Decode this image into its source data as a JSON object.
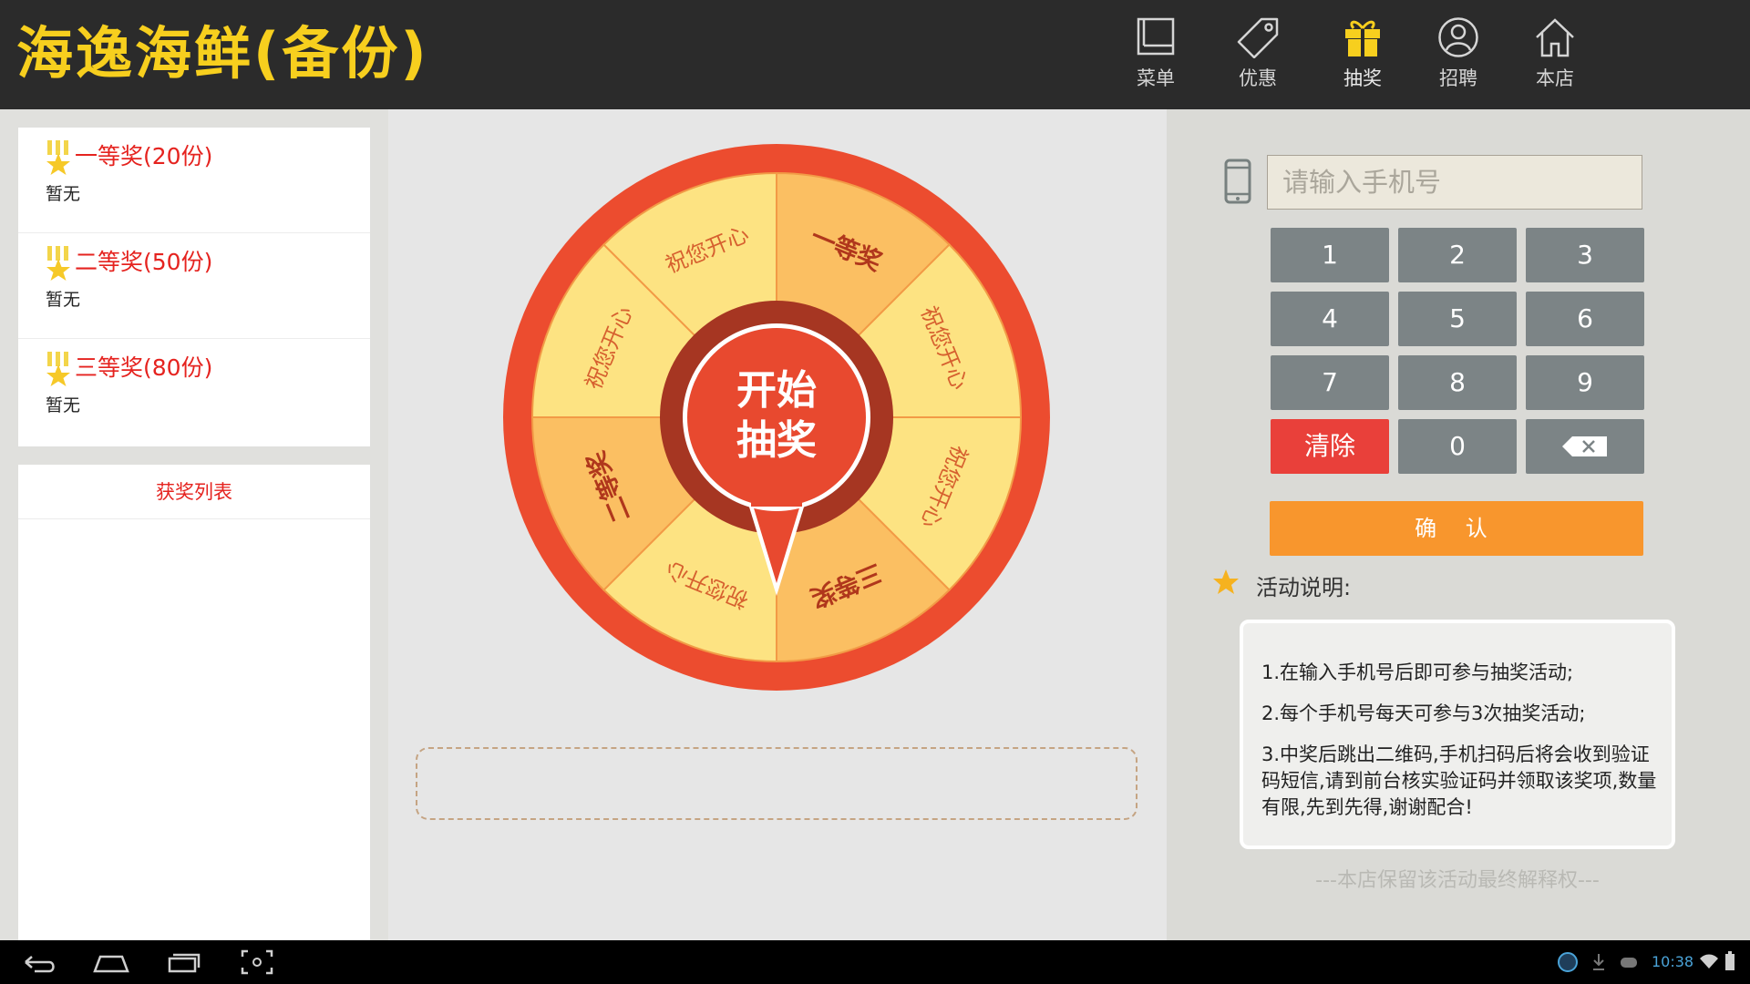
{
  "header": {
    "brand": "海逸海鲜(备份)",
    "nav": [
      {
        "icon": "book-icon",
        "label": "菜单"
      },
      {
        "icon": "tag-icon",
        "label": "优惠"
      },
      {
        "icon": "gift-icon",
        "label": "抽奖",
        "active": true
      },
      {
        "icon": "person-icon",
        "label": "招聘"
      },
      {
        "icon": "home-icon",
        "label": "本店"
      }
    ]
  },
  "prizes": [
    {
      "name": "一等奖(20份)",
      "winner": "暂无"
    },
    {
      "name": "二等奖(50份)",
      "winner": "暂无"
    },
    {
      "name": "三等奖(80份)",
      "winner": "暂无"
    }
  ],
  "winners": {
    "title": "获奖列表",
    "items": []
  },
  "wheel": {
    "segments": [
      "一等奖",
      "祝您开心",
      "祝您开心",
      "三等奖",
      "祝您开心",
      "二等奖",
      "祝您开心",
      "祝您开心"
    ],
    "button_line1": "开始",
    "button_line2": "抽奖"
  },
  "result": {
    "text": ""
  },
  "phone": {
    "placeholder": "请输入手机号",
    "value": ""
  },
  "keypad": {
    "digits": [
      "1",
      "2",
      "3",
      "4",
      "5",
      "6",
      "7",
      "8",
      "9",
      "0"
    ],
    "clear": "清除",
    "backspace_icon": "backspace-icon"
  },
  "confirm": "确 认",
  "rules": {
    "title": "活动说明:",
    "items": [
      "1.在输入手机号后即可参与抽奖活动;",
      "2.每个手机号每天可参与3次抽奖活动;",
      "3.中奖后跳出二维码,手机扫码后将会收到验证码短信,请到前台核实验证码并领取该奖项,数量有限,先到先得,谢谢配合!"
    ],
    "footer": "---本店保留该活动最终解释权---"
  },
  "system_bar": {
    "time": "10:38"
  },
  "colors": {
    "brand_yellow": "#f7cf1e",
    "accent_red": "#e5231f",
    "wheel_outer": "#ec4c2f",
    "wheel_light": "#fde382",
    "wheel_dark": "#fbbf62",
    "confirm_orange": "#f8962d",
    "clear_red": "#e9403a",
    "key_gray": "#7c8486"
  }
}
